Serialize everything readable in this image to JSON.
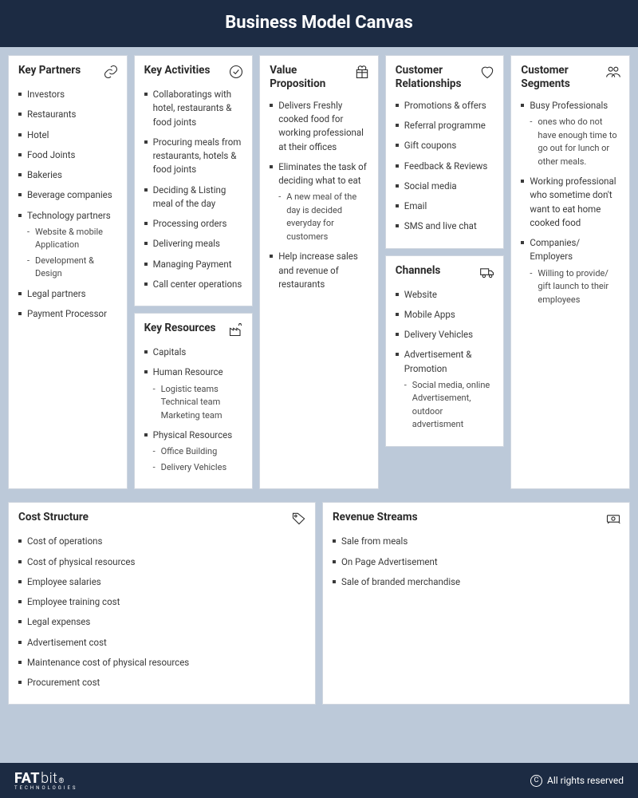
{
  "header": {
    "title": "Business Model Canvas"
  },
  "boxes": {
    "key_partners": {
      "title": "Key Partners",
      "items": [
        {
          "text": "Investors"
        },
        {
          "text": "Restaurants"
        },
        {
          "text": "Hotel"
        },
        {
          "text": "Food Joints"
        },
        {
          "text": "Bakeries"
        },
        {
          "text": "Beverage companies"
        },
        {
          "text": "Technology partners",
          "sub": [
            "Website & mobile Application",
            "Development & Design"
          ]
        },
        {
          "text": "Legal partners"
        },
        {
          "text": "Payment Processor"
        }
      ]
    },
    "key_activities": {
      "title": "Key Activities",
      "items": [
        {
          "text": "Collaboratings with hotel, restaurants & food joints"
        },
        {
          "text": "Procuring meals from restaurants, hotels & food joints"
        },
        {
          "text": "Deciding & Listing meal of the day"
        },
        {
          "text": "Processing orders"
        },
        {
          "text": "Delivering meals"
        },
        {
          "text": "Managing Payment"
        },
        {
          "text": "Call center operations"
        }
      ]
    },
    "key_resources": {
      "title": "Key Resources",
      "items": [
        {
          "text": "Capitals"
        },
        {
          "text": "Human Resource",
          "sub": [
            "Logistic teams Technical team Marketing team"
          ]
        },
        {
          "text": "Physical Resources",
          "sub": [
            "Office Building",
            "Delivery Vehicles"
          ]
        }
      ]
    },
    "value_proposition": {
      "title": "Value Proposition",
      "items": [
        {
          "text": "Delivers Freshly cooked food for working professional at their offices"
        },
        {
          "text": "Eliminates the task of deciding what to eat",
          "sub": [
            "A new meal of the day is decided everyday for customers"
          ]
        },
        {
          "text": "Help increase sales and revenue of restaurants"
        }
      ]
    },
    "customer_relationships": {
      "title": "Customer Relationships",
      "items": [
        {
          "text": "Promotions & offers"
        },
        {
          "text": "Referral programme"
        },
        {
          "text": "Gift coupons"
        },
        {
          "text": "Feedback & Reviews"
        },
        {
          "text": "Social media"
        },
        {
          "text": "Email"
        },
        {
          "text": "SMS and live chat"
        }
      ]
    },
    "channels": {
      "title": "Channels",
      "items": [
        {
          "text": "Website"
        },
        {
          "text": "Mobile Apps"
        },
        {
          "text": "Delivery Vehicles"
        },
        {
          "text": "Advertisement & Promotion",
          "sub": [
            "Social media, online Advertisement, outdoor advertisment"
          ]
        }
      ]
    },
    "customer_segments": {
      "title": "Customer Segments",
      "items": [
        {
          "text": "Busy Professionals",
          "sub": [
            "ones who do not have enough time to go out for lunch or other meals."
          ]
        },
        {
          "text": "Working professional who sometime don't want to eat home cooked food"
        },
        {
          "text": "Companies/ Employers",
          "sub": [
            "Willing to provide/ gift launch to their employees"
          ]
        }
      ]
    },
    "cost_structure": {
      "title": "Cost Structure",
      "items": [
        {
          "text": "Cost of operations"
        },
        {
          "text": "Cost of physical resources"
        },
        {
          "text": "Employee salaries"
        },
        {
          "text": "Employee training cost"
        },
        {
          "text": "Legal expenses"
        },
        {
          "text": "Advertisement cost"
        },
        {
          "text": "Maintenance cost of physical resources"
        },
        {
          "text": "Procurement cost"
        }
      ]
    },
    "revenue_streams": {
      "title": "Revenue  Streams",
      "items": [
        {
          "text": "Sale from meals"
        },
        {
          "text": "On Page Advertisement"
        },
        {
          "text": "Sale of branded merchandise"
        }
      ]
    }
  },
  "footer": {
    "brand_bold": "FAT",
    "brand_thin": "bit",
    "brand_sub": "TECHNOLOGIES",
    "rights": "All rights reserved"
  }
}
